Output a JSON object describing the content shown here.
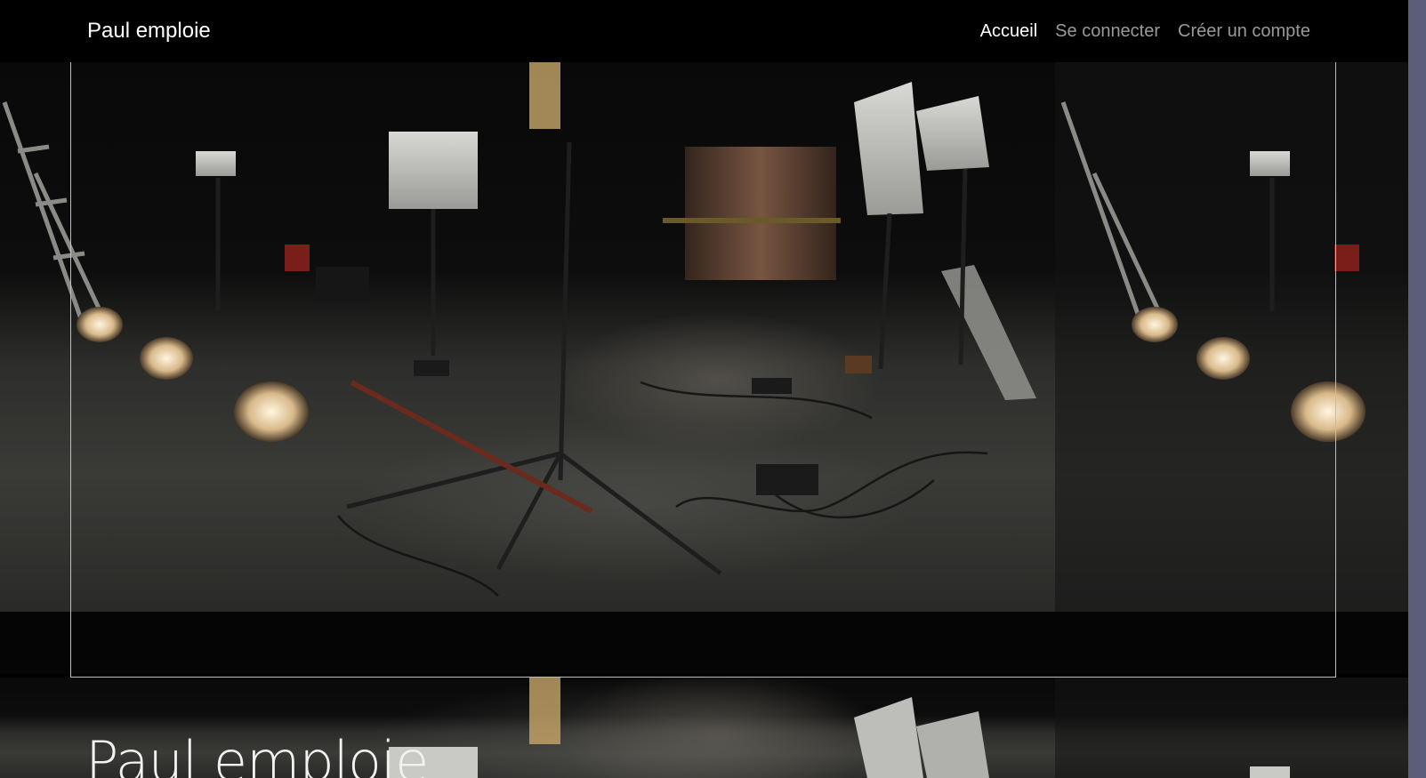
{
  "navbar": {
    "brand": "Paul emploie",
    "links": [
      {
        "label": "Accueil",
        "active": true
      },
      {
        "label": "Se connecter",
        "active": false
      },
      {
        "label": "Créer un compte",
        "active": false
      }
    ]
  },
  "section2": {
    "title": "Paul emploie"
  },
  "colors": {
    "background": "#000000",
    "nav_active": "#ffffff",
    "nav_inactive": "#9a9a9a",
    "scrollbar_track": "#5a5e7a"
  }
}
